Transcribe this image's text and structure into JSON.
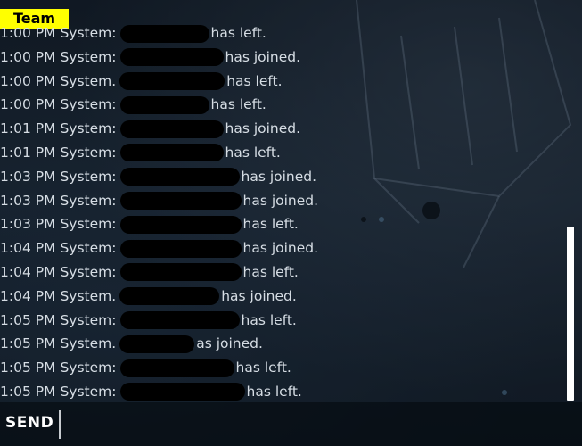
{
  "tab": {
    "label": "Team"
  },
  "messages": [
    {
      "time": "1:00 PM",
      "sender": "System:",
      "event": "has left."
    },
    {
      "time": "1:00 PM",
      "sender": "System:",
      "event": "has joined."
    },
    {
      "time": "1:00 PM",
      "sender": "System.",
      "event": "has left."
    },
    {
      "time": "1:00 PM",
      "sender": "System:",
      "event": "has left."
    },
    {
      "time": "1:01 PM",
      "sender": "System:",
      "event": "has joined."
    },
    {
      "time": "1:01 PM",
      "sender": "System:",
      "event": "has left."
    },
    {
      "time": "1:03 PM",
      "sender": "System:",
      "event": "has joined."
    },
    {
      "time": "1:03 PM",
      "sender": "System:",
      "event": "has joined."
    },
    {
      "time": "1:03 PM",
      "sender": "System:",
      "event": "has left."
    },
    {
      "time": "1:04 PM",
      "sender": "System:",
      "event": "has joined."
    },
    {
      "time": "1:04 PM",
      "sender": "System:",
      "event": "has left."
    },
    {
      "time": "1:04 PM",
      "sender": "System.",
      "event": "has joined."
    },
    {
      "time": "1:05 PM",
      "sender": "System:",
      "event": "has left."
    },
    {
      "time": "1:05 PM",
      "sender": "System.",
      "event": "as joined."
    },
    {
      "time": "1:05 PM",
      "sender": "System:",
      "event": "has left."
    },
    {
      "time": "1:05 PM",
      "sender": "System:",
      "event": "has left."
    }
  ],
  "input": {
    "send_label": "SEND",
    "value": ""
  }
}
